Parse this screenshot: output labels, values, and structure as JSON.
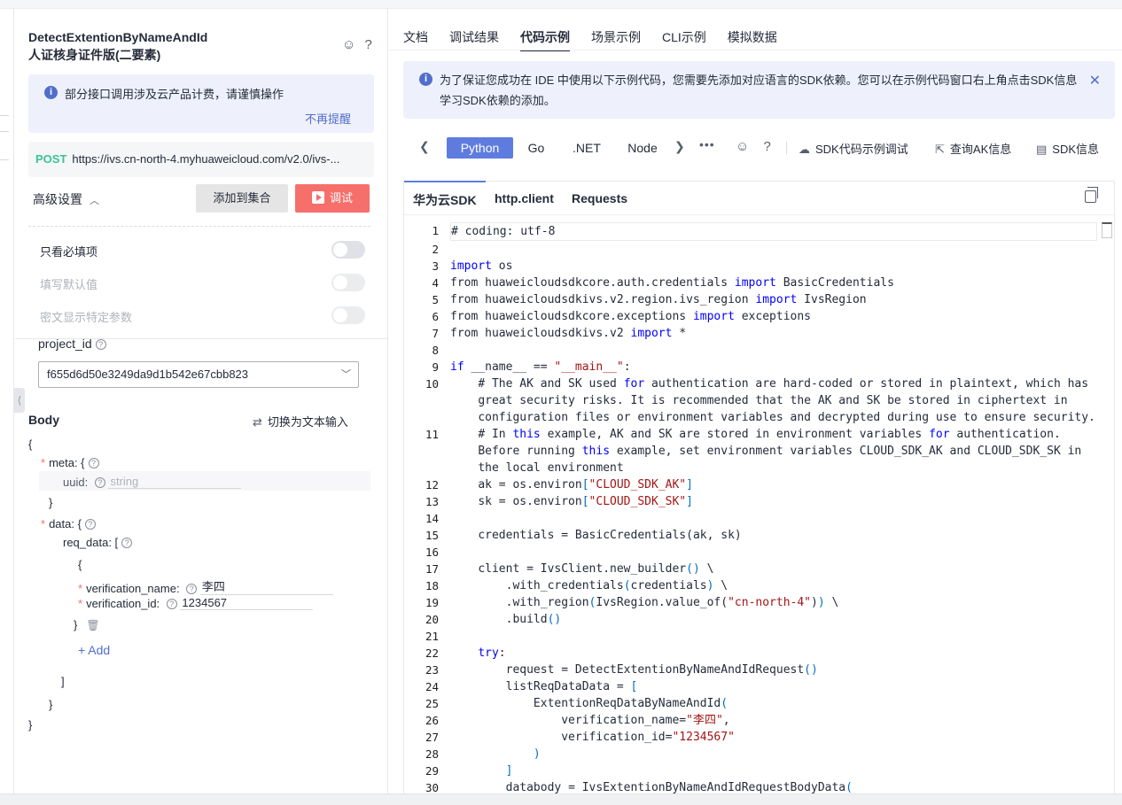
{
  "left": {
    "api_title_line1": "DetectExtentionByNameAndId",
    "api_title_line2": "人证核身证件版(二要素)",
    "title_icons": "☺ ?",
    "notice": {
      "text": "部分接口调用涉及云产品计费，请谨慎操作",
      "dismiss": "不再提醒",
      "icon": "i"
    },
    "endpoint": {
      "method": "POST",
      "url": "https://ivs.cn-north-4.myhuaweicloud.com/v2.0/ivs-..."
    },
    "advanced_label": "高级设置",
    "add_to_collection": "添加到集合",
    "debug_button": "调试",
    "toggles": [
      {
        "label": "只看必填项",
        "enabled": true
      },
      {
        "label": "填写默认值",
        "enabled": false
      },
      {
        "label": "密文显示特定参数",
        "enabled": false
      }
    ],
    "project_id_label": "project_id",
    "project_id_value": "f655d6d50e3249da9d1b542e67cbb823",
    "body_label": "Body",
    "switch_text": "切换为文本输入",
    "json": {
      "open_brace": "{",
      "meta_label": "meta: {",
      "uuid_label": "uuid:",
      "uuid_placeholder": "string",
      "meta_close": "}",
      "data_label": "data: {",
      "req_data_label": "req_data: [",
      "item_open": "{",
      "verification_name_label": "verification_name:",
      "verification_name_value": "李四",
      "verification_id_label": "verification_id:",
      "verification_id_value": "1234567",
      "item_close": "}",
      "add_label": "+ Add",
      "array_close": "]",
      "data_close": "}",
      "close_brace": "}"
    }
  },
  "right": {
    "tabs": [
      "文档",
      "调试结果",
      "代码示例",
      "场景示例",
      "CLI示例",
      "模拟数据"
    ],
    "active_tab": "代码示例",
    "banner": "为了保证您成功在 IDE 中使用以下示例代码，您需要先添加对应语言的SDK依赖。您可以在示例代码窗口右上角点击SDK信息 学习SDK依赖的添加。",
    "languages": [
      "Python",
      "Go",
      ".NET",
      "Node"
    ],
    "active_language": "Python",
    "tools": [
      "SDK代码示例调试",
      "查询AK信息",
      "SDK信息"
    ],
    "subtabs": [
      "华为云SDK",
      "http.client",
      "Requests"
    ],
    "code_lines": [
      {
        "n": "1",
        "html": "# coding: utf-8"
      },
      {
        "n": "2",
        "html": ""
      },
      {
        "n": "3",
        "html": "<span class=\"kw\">import</span> os"
      },
      {
        "n": "4",
        "html": "from huaweicloudsdkcore.auth.credentials <span class=\"kw\">import</span> BasicCredentials"
      },
      {
        "n": "5",
        "html": "from huaweicloudsdkivs.v2.region.ivs_region <span class=\"kw\">import</span> IvsRegion"
      },
      {
        "n": "6",
        "html": "from huaweicloudsdkcore.exceptions <span class=\"kw\">import</span> exceptions"
      },
      {
        "n": "7",
        "html": "from huaweicloudsdkivs.v2 <span class=\"kw\">import</span> *"
      },
      {
        "n": "8",
        "html": ""
      },
      {
        "n": "9",
        "html": "<span class=\"kw\">if</span> __name__ == <span class=\"str\">\"__main__\"</span>:"
      },
      {
        "n": "10",
        "html": "    # The AK and SK used <span class=\"kw\">for</span> authentication are hard-coded or stored in plaintext, which has\n    great security risks. It is recommended that the AK and SK be stored in ciphertext in\n    configuration files or environment variables and decrypted during use to ensure security."
      },
      {
        "n": "11",
        "html": "    # In <span class=\"kw\">this</span> example, AK and SK are stored in environment variables <span class=\"kw\">for</span> authentication.\n    Before running <span class=\"kw\">this</span> example, set environment variables CLOUD_SDK_AK and CLOUD_SDK_SK in\n    the local environment"
      },
      {
        "n": "12",
        "html": "    ak = os.environ<span class=\"cyan\">[</span><span class=\"str\">\"CLOUD_SDK_AK\"</span><span class=\"cyan\">]</span>"
      },
      {
        "n": "13",
        "html": "    sk = os.environ<span class=\"cyan\">[</span><span class=\"str\">\"CLOUD_SDK_SK\"</span><span class=\"cyan\">]</span>"
      },
      {
        "n": "14",
        "html": ""
      },
      {
        "n": "15",
        "html": "    credentials = BasicCredentials(ak, sk)"
      },
      {
        "n": "16",
        "html": ""
      },
      {
        "n": "17",
        "html": "    client = IvsClient.new_builder<span class=\"cyan\">()</span> \\"
      },
      {
        "n": "18",
        "html": "        .with_credentials<span class=\"cyan\">(</span>credentials<span class=\"cyan\">)</span> \\"
      },
      {
        "n": "19",
        "html": "        .with_region<span class=\"cyan\">(</span>IvsRegion.value_of(<span class=\"str\">\"cn-north-4\"</span>)<span class=\"cyan\">)</span> \\"
      },
      {
        "n": "20",
        "html": "        .build<span class=\"cyan\">()</span>"
      },
      {
        "n": "21",
        "html": ""
      },
      {
        "n": "22",
        "html": "    <span class=\"kw\">try</span>:"
      },
      {
        "n": "23",
        "html": "        request = DetectExtentionByNameAndIdRequest<span class=\"cyan\">()</span>"
      },
      {
        "n": "24",
        "html": "        listReqDataData = <span class=\"cyan\">[</span>"
      },
      {
        "n": "25",
        "html": "            ExtentionReqDataByNameAndId<span class=\"cyan\">(</span>"
      },
      {
        "n": "26",
        "html": "                verification_name=<span class=\"str\">\"李四\"</span>,"
      },
      {
        "n": "27",
        "html": "                verification_id=<span class=\"str\">\"1234567\"</span>"
      },
      {
        "n": "28",
        "html": "            <span class=\"cyan\">)</span>"
      },
      {
        "n": "29",
        "html": "        <span class=\"cyan\">]</span>"
      },
      {
        "n": "30",
        "html": "        databody = IvsExtentionByNameAndIdRequestBodyData<span class=\"cyan\">(</span>"
      }
    ]
  }
}
